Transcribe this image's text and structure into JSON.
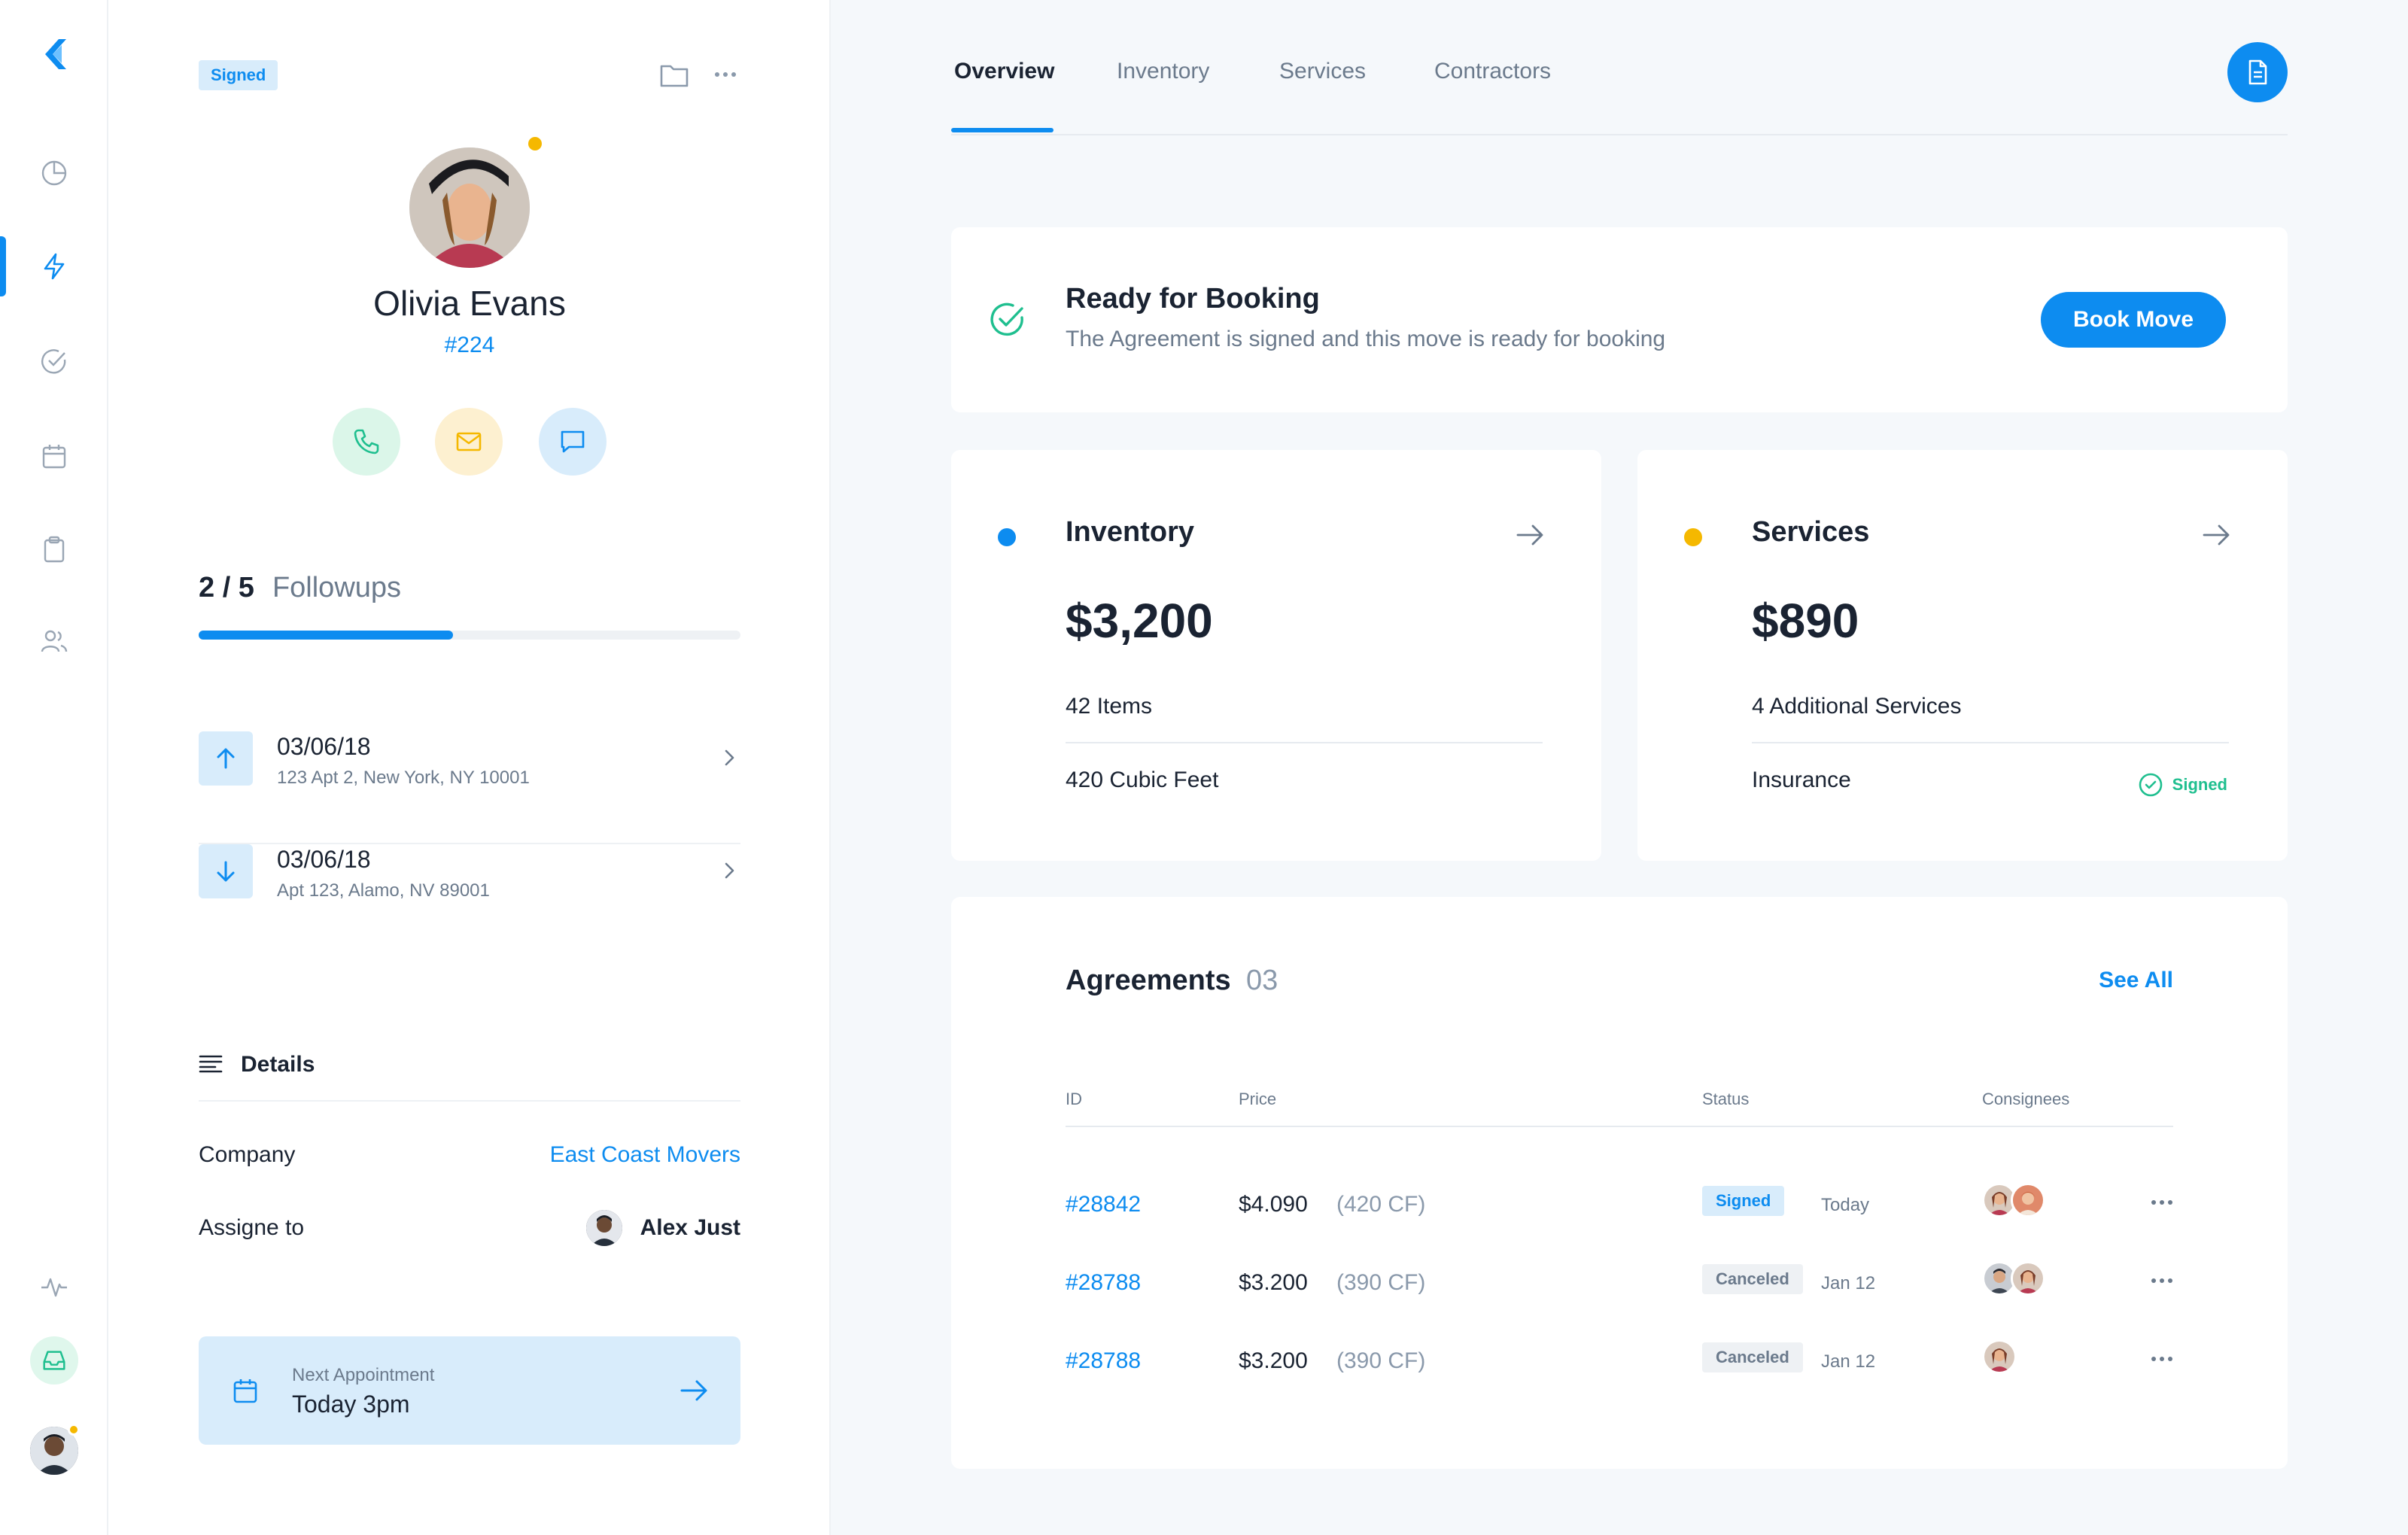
{
  "rail": {
    "items": [
      {
        "icon": "pie-chart-icon",
        "active": false
      },
      {
        "icon": "lightning-icon",
        "active": true
      },
      {
        "icon": "check-circle-icon",
        "active": false
      },
      {
        "icon": "calendar-icon",
        "active": false
      },
      {
        "icon": "clipboard-icon",
        "active": false
      },
      {
        "icon": "users-icon",
        "active": false
      }
    ],
    "bottom": [
      "activity-icon",
      "inbox-icon",
      "avatar"
    ]
  },
  "profile": {
    "badge": "Signed",
    "name": "Olivia Evans",
    "ticket": "#224",
    "followups": {
      "count": "2 / 5",
      "label": "Followups",
      "progress": 0.47
    },
    "stops": [
      {
        "direction": "up",
        "date": "03/06/18",
        "address": "123 Apt 2, New York, NY 10001"
      },
      {
        "direction": "down",
        "date": "03/06/18",
        "address": "Apt 123, Alamo, NV 89001"
      }
    ],
    "details": {
      "title": "Details",
      "company_label": "Company",
      "company_value": "East Coast Movers",
      "assignee_label": "Assigne to",
      "assignee_value": "Alex Just"
    },
    "next_appointment": {
      "label": "Next Appointment",
      "value": "Today 3pm"
    }
  },
  "tabs": [
    "Overview",
    "Inventory",
    "Services",
    "Contractors"
  ],
  "ready": {
    "title": "Ready for Booking",
    "subtitle": "The Agreement is signed and this move is ready for booking",
    "button": "Book Move"
  },
  "inventory": {
    "title": "Inventory",
    "amount": "$3,200",
    "line1": "42 Items",
    "line2": "420 Cubic Feet",
    "color": "#0d8cf0"
  },
  "services": {
    "title": "Services",
    "amount": "$890",
    "line1": "4 Additional Services",
    "line2": "Insurance",
    "signed": "Signed",
    "color": "#f5b800"
  },
  "agreements": {
    "title": "Agreements",
    "count": "03",
    "see_all": "See All",
    "headers": {
      "id": "ID",
      "price": "Price",
      "status": "Status",
      "consignees": "Consignees"
    },
    "rows": [
      {
        "id": "#28842",
        "price": "$4.090",
        "cf": "(420 CF)",
        "status": "Signed",
        "when": "Today",
        "consignees": 2
      },
      {
        "id": "#28788",
        "price": "$3.200",
        "cf": "(390 CF)",
        "status": "Canceled",
        "when": "Jan 12",
        "consignees": 2
      },
      {
        "id": "#28788",
        "price": "$3.200",
        "cf": "(390 CF)",
        "status": "Canceled",
        "when": "Jan 12",
        "consignees": 1
      }
    ]
  }
}
